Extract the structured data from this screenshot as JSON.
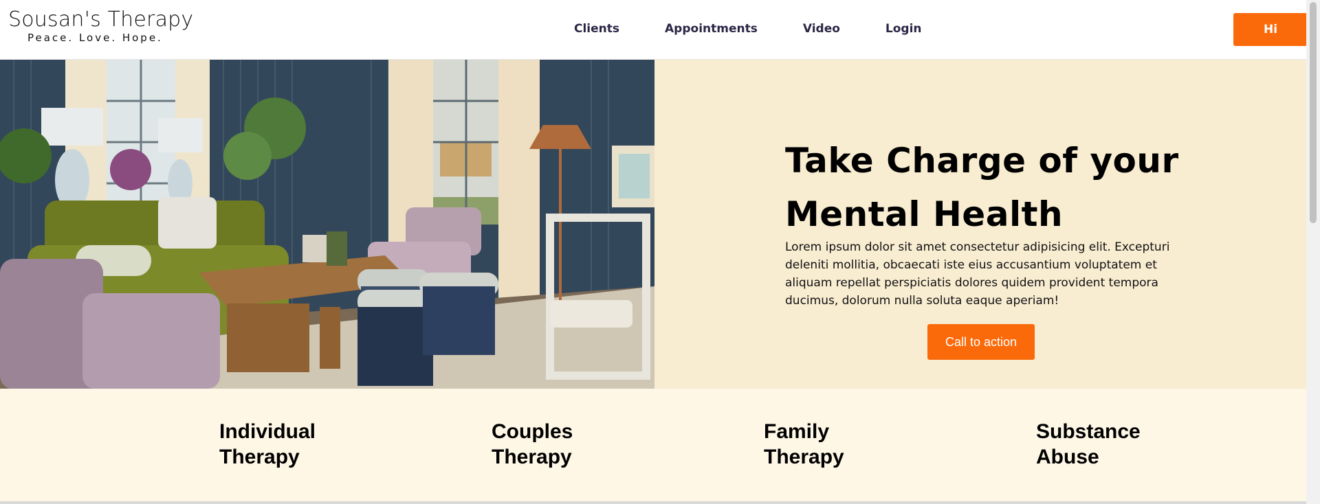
{
  "header": {
    "logo_title": "Sousan's Therapy",
    "logo_tagline": "Peace. Love. Hope.",
    "nav": [
      {
        "label": "Clients"
      },
      {
        "label": "Appointments"
      },
      {
        "label": "Video"
      },
      {
        "label": "Login"
      }
    ],
    "hi_button_label": "Hi"
  },
  "hero": {
    "image_icon": "living-room-photo",
    "title": "Take Charge of your Mental Health",
    "body": "Lorem ipsum dolor sit amet consectetur adipisicing elit. Excepturi deleniti mollitia, obcaecati iste eius accusantium voluptatem et aliquam repellat perspiciatis dolores quidem provident tempora ducimus, dolorum nulla soluta eaque aperiam!",
    "cta_label": "Call to action"
  },
  "services": [
    {
      "label": "Individual\nTherapy"
    },
    {
      "label": "Couples\nTherapy"
    },
    {
      "label": "Family\nTherapy"
    },
    {
      "label": "Substance\nAbuse"
    }
  ],
  "colors": {
    "accent": "#fb6a0a",
    "hero_panel": "#f8ecd1",
    "services_bg": "#fef7e6",
    "nav_text": "#2b2545"
  }
}
